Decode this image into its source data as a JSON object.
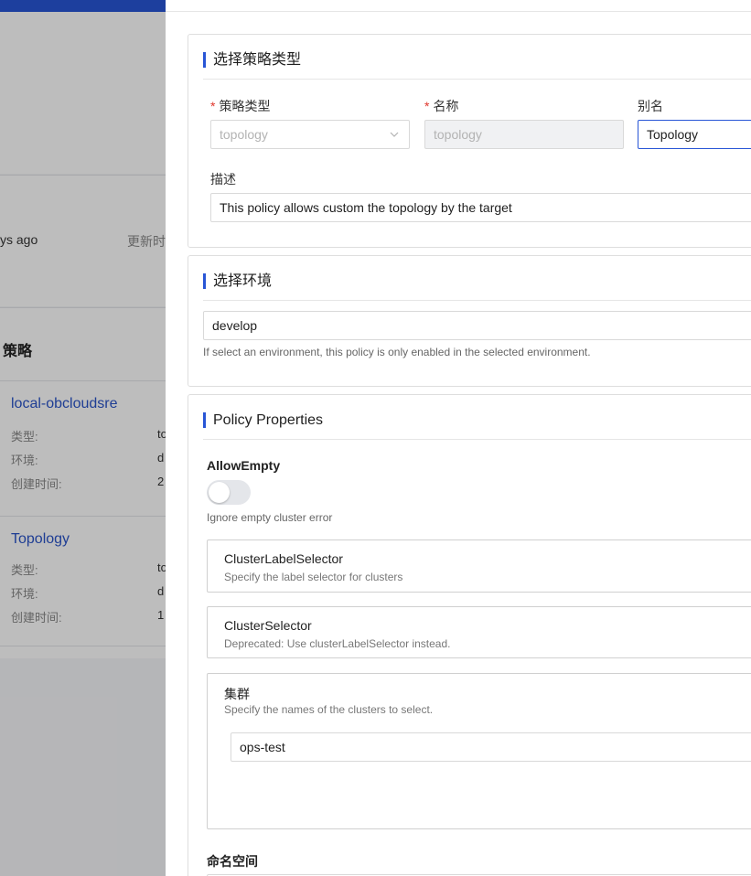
{
  "background": {
    "updated_ago": "ys ago",
    "updated_label": "更新时",
    "section_title": "策略",
    "cards": [
      {
        "title": "local-obcloudsre",
        "fields": [
          {
            "label": "类型:",
            "value": "to"
          },
          {
            "label": "环境:",
            "value": "d"
          },
          {
            "label": "创建时间:",
            "value": "2"
          }
        ]
      },
      {
        "title": "Topology",
        "fields": [
          {
            "label": "类型:",
            "value": "to"
          },
          {
            "label": "环境:",
            "value": "d"
          },
          {
            "label": "创建时间:",
            "value": "1"
          }
        ]
      }
    ]
  },
  "policy_type_section": {
    "title": "选择策略类型",
    "type_label": "策略类型",
    "type_value": "topology",
    "name_label": "名称",
    "name_value": "topology",
    "alias_label": "别名",
    "alias_value": "Topology",
    "description_label": "描述",
    "description_value": "This policy allows custom the topology by the target",
    "required_mark": "*"
  },
  "environment_section": {
    "title": "选择环境",
    "env_value": "develop",
    "help": "If select an environment, this policy is only enabled in the selected environment."
  },
  "properties_section": {
    "title": "Policy Properties",
    "allow_empty_label": "AllowEmpty",
    "allow_empty_on": false,
    "allow_empty_help": "Ignore empty cluster error",
    "cluster_label_selector_title": "ClusterLabelSelector",
    "cluster_label_selector_desc": "Specify the label selector for clusters",
    "cluster_selector_title": "ClusterSelector",
    "cluster_selector_desc": "Deprecated: Use clusterLabelSelector instead.",
    "clusters_title": "集群",
    "clusters_desc": "Specify the names of the clusters to select.",
    "cluster_value": "ops-test",
    "namespace_label": "命名空间"
  },
  "colors": {
    "accent": "#2855d6",
    "required": "#e0362c",
    "link": "#2b54c8"
  }
}
